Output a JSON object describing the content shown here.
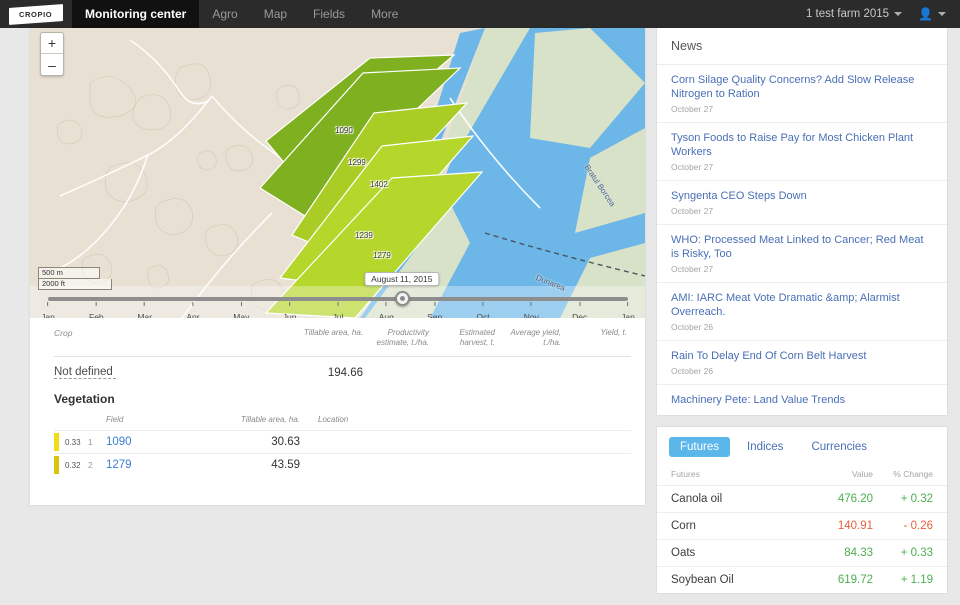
{
  "topnav": {
    "logo_text": "CROPIO",
    "items": [
      {
        "label": "Monitoring center",
        "active": true
      },
      {
        "label": "Agro",
        "active": false
      },
      {
        "label": "Map",
        "active": false
      },
      {
        "label": "Fields",
        "active": false
      },
      {
        "label": "More",
        "active": false
      }
    ],
    "farm_selector": "1 test farm 2015",
    "user_icon": "user-icon"
  },
  "map": {
    "zoom_in_label": "+",
    "zoom_out_label": "–",
    "scale_metric": "500 m",
    "scale_imperial": "2000 ft",
    "field_labels": [
      "1090",
      "1299",
      "1402",
      "1239",
      "1279"
    ],
    "river_labels": [
      "Bratul Borcea",
      "Dunarea"
    ],
    "colors": {
      "land": "#e8e0d2",
      "water": "#6cb6e8",
      "field_dark": "#7fb020",
      "field_light": "#b5d62b"
    }
  },
  "timeline": {
    "selected_date": "August 11, 2015",
    "handle_percent": 61,
    "months": [
      "Jan",
      "Feb",
      "Mar",
      "Apr",
      "May",
      "Jun",
      "Jul",
      "Aug",
      "Sep",
      "Oct",
      "Nov",
      "Dec",
      "Jan"
    ]
  },
  "summary": {
    "headers": {
      "crop": "Crop",
      "tillable_area": "Tillable area, ha.",
      "productivity": "Productivity estimate, t./ha.",
      "estimated_harvest": "Estimated harvest, t.",
      "average_yield": "Average yield, t./ha.",
      "yield": "Yield, t."
    },
    "row": {
      "crop": "Not defined",
      "tillable_area": "194.66",
      "productivity": "",
      "estimated_harvest": "",
      "average_yield": "",
      "yield": ""
    }
  },
  "vegetation": {
    "title": "Vegetation",
    "headers": {
      "field": "Field",
      "tillable_area": "Tillable area, ha.",
      "location": "Location"
    },
    "rows": [
      {
        "score": "0.33",
        "index": "1",
        "field": "1090",
        "tillable_area": "30.63",
        "location": "",
        "chip_color": "#f0dd16"
      },
      {
        "score": "0.32",
        "index": "2",
        "field": "1279",
        "tillable_area": "43.59",
        "location": "",
        "chip_color": "#dbc40f"
      }
    ]
  },
  "news": {
    "title": "News",
    "items": [
      {
        "headline": "Corn Silage Quality Concerns? Add Slow Release Nitrogen to Ration",
        "date": "October 27"
      },
      {
        "headline": "Tyson Foods to Raise Pay for Most Chicken Plant Workers",
        "date": "October 27"
      },
      {
        "headline": "Syngenta CEO Steps Down",
        "date": "October 27"
      },
      {
        "headline": "WHO: Processed Meat Linked to Cancer; Red Meat is Risky, Too",
        "date": "October 27"
      },
      {
        "headline": "AMI: IARC Meat Vote Dramatic &amp; Alarmist Overreach.",
        "date": "October 26"
      },
      {
        "headline": "Rain To Delay End Of Corn Belt Harvest",
        "date": "October 26"
      },
      {
        "headline": "Machinery Pete: Land Value Trends",
        "date": ""
      }
    ]
  },
  "markets": {
    "tabs": [
      {
        "label": "Futures",
        "active": true
      },
      {
        "label": "Indices",
        "active": false
      },
      {
        "label": "Currencies",
        "active": false
      }
    ],
    "headers": {
      "name": "Futures",
      "value": "Value",
      "change": "% Change"
    },
    "rows": [
      {
        "name": "Canola oil",
        "value": "476.20",
        "change": "+ 0.32",
        "direction": "up"
      },
      {
        "name": "Corn",
        "value": "140.91",
        "change": "- 0.26",
        "direction": "down"
      },
      {
        "name": "Oats",
        "value": "84.33",
        "change": "+ 0.33",
        "direction": "up"
      },
      {
        "name": "Soybean Oil",
        "value": "619.72",
        "change": "+ 1.19",
        "direction": "up"
      }
    ],
    "colors": {
      "up": "#4caf50",
      "down": "#e8603c",
      "tab_active_bg": "#5bb6ea"
    }
  }
}
